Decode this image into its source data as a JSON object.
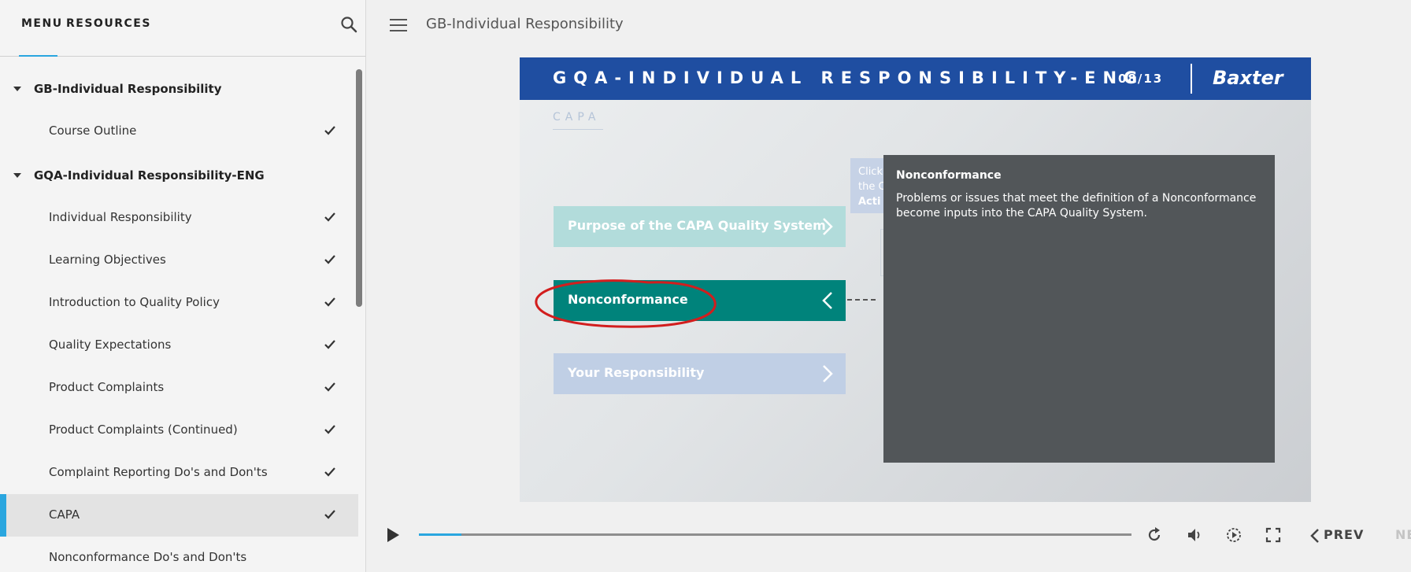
{
  "sidebar": {
    "tabs": {
      "menu": "MENU",
      "resources": "RESOURCES"
    },
    "sections": [
      {
        "title": "GB-Individual Responsibility",
        "items": [
          {
            "label": "Course Outline",
            "completed": true
          }
        ]
      },
      {
        "title": "GQA-Individual Responsibility-ENG",
        "items": [
          {
            "label": "Individual Responsibility",
            "completed": true
          },
          {
            "label": "Learning Objectives",
            "completed": true
          },
          {
            "label": "Introduction to Quality Policy",
            "completed": true
          },
          {
            "label": "Quality Expectations",
            "completed": true
          },
          {
            "label": "Product Complaints",
            "completed": true
          },
          {
            "label": "Product Complaints (Continued)",
            "completed": true
          },
          {
            "label": "Complaint Reporting Do's and Don'ts",
            "completed": true
          },
          {
            "label": "CAPA",
            "completed": true,
            "active": true
          },
          {
            "label": "Nonconformance Do's and Don'ts",
            "completed": false
          }
        ]
      }
    ]
  },
  "header": {
    "title": "GB-Individual Responsibility"
  },
  "slide": {
    "title": "GQA-INDIVIDUAL RESPONSIBILITY-ENG",
    "counter": "08/13",
    "brand": "Baxter",
    "section_label": "CAPA",
    "click_hint": [
      "Click",
      "the C",
      "Acti"
    ],
    "options": {
      "purpose": "Purpose of the CAPA Quality System",
      "nonconformance": "Nonconformance",
      "responsibility": "Your Responsibility"
    },
    "popup": {
      "title": "Nonconformance",
      "body": "Problems or issues that meet the definition of a Nonconformance become inputs into the CAPA Quality System."
    }
  },
  "player": {
    "progress": 0.06,
    "prev_label": "PREV",
    "next_label": "NE"
  },
  "colors": {
    "accent": "#2aa6df",
    "header_blue": "#1f4ea1",
    "teal": "#00837b",
    "popup_gray": "#525659"
  }
}
